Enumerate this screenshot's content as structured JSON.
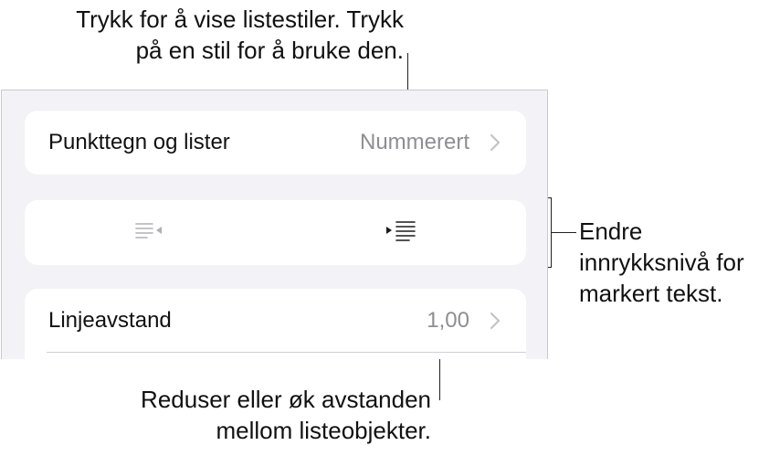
{
  "callouts": {
    "top": [
      "Trykk for å vise listestiler. Trykk",
      "på en stil for å bruke den."
    ],
    "right": [
      "Endre",
      "innrykksnivå for",
      "markert tekst."
    ],
    "bottom": [
      "Reduser eller øk avstanden",
      "mellom listeobjekter."
    ]
  },
  "panel": {
    "bullets": {
      "label": "Punkttegn og lister",
      "value": "Nummerert",
      "icon": "chevron-right-icon"
    },
    "indent": {
      "decrease_icon": "decrease-indent-icon",
      "decrease_enabled": false,
      "increase_icon": "increase-indent-icon",
      "increase_enabled": true
    },
    "spacing": {
      "label": "Linjeavstand",
      "value": "1,00",
      "icon": "chevron-right-icon"
    }
  },
  "colors": {
    "panel_bg": "#f2f2f7",
    "card_bg": "#ffffff",
    "secondary_text": "#8e8e93",
    "disabled_icon": "#b0b0b5",
    "enabled_icon": "#1a1a1a"
  }
}
